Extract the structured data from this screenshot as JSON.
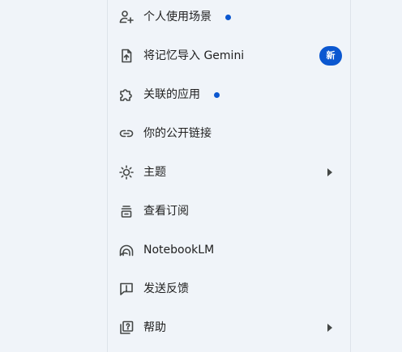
{
  "menu": {
    "items": [
      {
        "id": "personal-context",
        "label": "个人使用场景",
        "icon": "person-spark-icon",
        "indicator": "dot"
      },
      {
        "id": "import-memory",
        "label": "将记忆导入 Gemini",
        "icon": "file-upload-icon",
        "badge": "新"
      },
      {
        "id": "connected-apps",
        "label": "关联的应用",
        "icon": "puzzle-icon",
        "indicator": "dot"
      },
      {
        "id": "public-links",
        "label": "你的公开链接",
        "icon": "link-icon"
      },
      {
        "id": "theme",
        "label": "主题",
        "icon": "theme-sun-icon",
        "submenu": true
      },
      {
        "id": "subscriptions",
        "label": "查看订阅",
        "icon": "subscription-icon"
      },
      {
        "id": "notebooklm",
        "label": "NotebookLM",
        "icon": "notebooklm-icon"
      },
      {
        "id": "feedback",
        "label": "发送反馈",
        "icon": "feedback-icon"
      },
      {
        "id": "help",
        "label": "帮助",
        "icon": "help-icon",
        "submenu": true
      }
    ]
  },
  "colors": {
    "accent": "#0b57d0",
    "background": "#f0f4f9",
    "text": "#1f1f1f",
    "icon": "#444746"
  }
}
